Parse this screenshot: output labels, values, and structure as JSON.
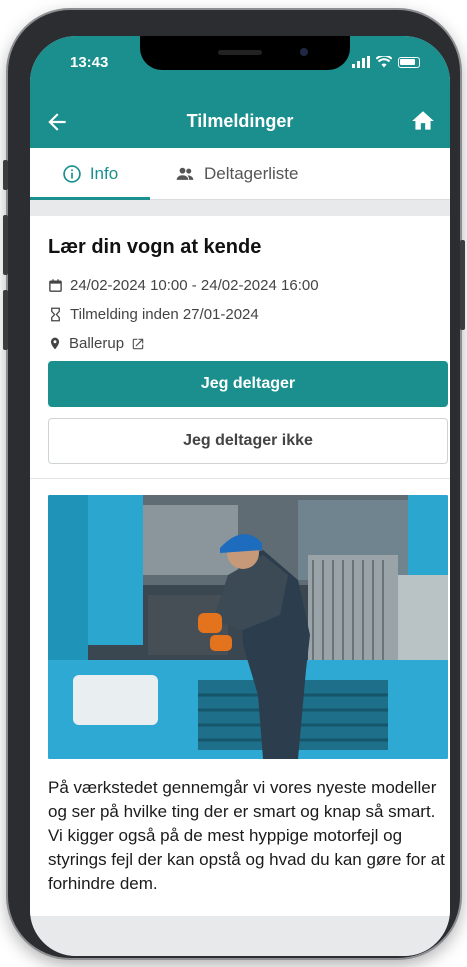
{
  "status": {
    "time": "13:43"
  },
  "appbar": {
    "title": "Tilmeldinger"
  },
  "tabs": [
    {
      "label": "Info",
      "icon": "info-icon",
      "active": true
    },
    {
      "label": "Deltagerliste",
      "icon": "people-icon",
      "active": false
    }
  ],
  "event": {
    "title": "Lær din vogn at kende",
    "datetime": "24/02-2024 10:00 - 24/02-2024 16:00",
    "deadline": "Tilmelding inden 27/01-2024",
    "location": "Ballerup",
    "accept_label": "Jeg deltager",
    "decline_label": "Jeg deltager ikke",
    "description": "På værkstedet gennemgår vi vores nyeste modeller og ser på hvilke ting der er smart og knap så smart. Vi kigger også på de mest hyppige motorfejl og styrings fejl der kan opstå og hvad du kan gøre for at forhindre dem."
  },
  "colors": {
    "accent": "#1a8f8d",
    "background": "#e7e9eb"
  }
}
